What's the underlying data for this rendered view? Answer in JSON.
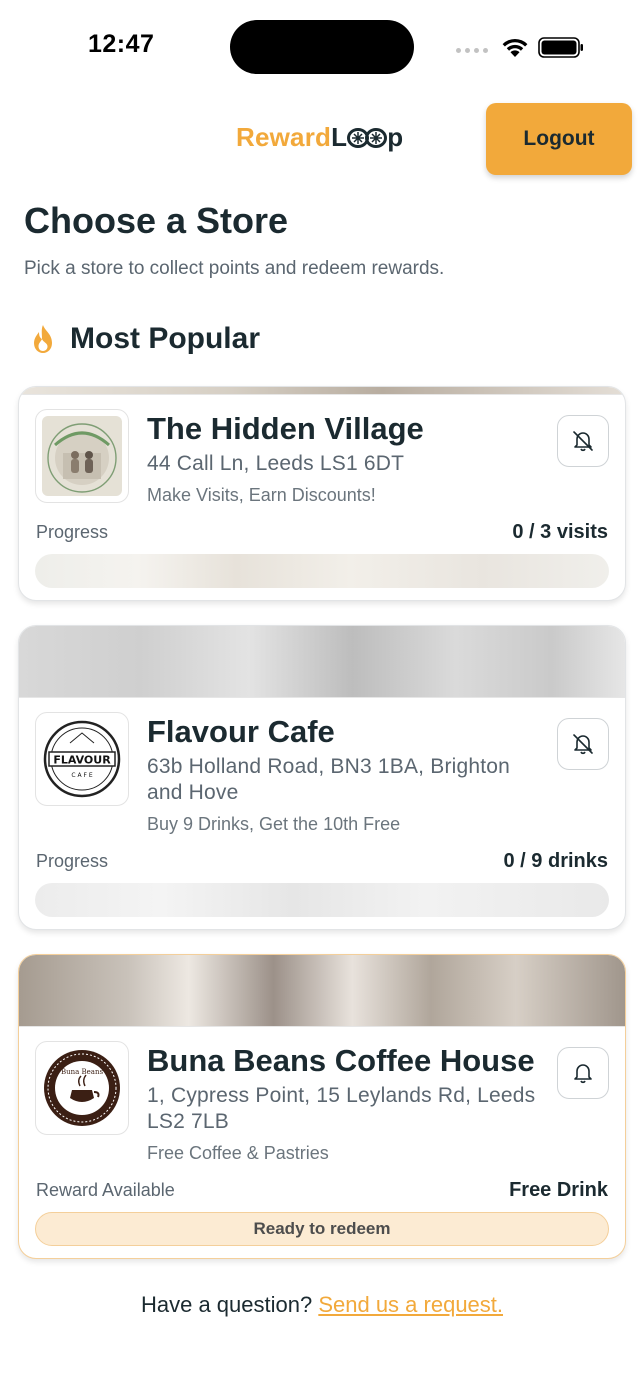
{
  "status_bar": {
    "time": "12:47",
    "icons": [
      "cellular-signal-icon",
      "wifi-icon",
      "battery-icon"
    ]
  },
  "header": {
    "logo_part1": "Reward",
    "logo_part2": "L",
    "logo_part3": "p",
    "logout_label": "Logout"
  },
  "page": {
    "title": "Choose a Store",
    "subtitle": "Pick a store to collect points and redeem rewards."
  },
  "section": {
    "icon": "fire-icon",
    "title": "Most Popular"
  },
  "stores": [
    {
      "name": "The Hidden Village",
      "address": "44 Call Ln, Leeds LS1 6DT",
      "offer": "Make Visits, Earn Discounts!",
      "status_label": "Progress",
      "status_value": "0 / 3 visits",
      "progress_fraction": 0,
      "notifications": "muted",
      "logo_text": "The Hidden Village"
    },
    {
      "name": "Flavour Cafe",
      "address": "63b Holland Road, BN3 1BA, Brighton and Hove",
      "offer": "Buy 9 Drinks, Get the 10th Free",
      "status_label": "Progress",
      "status_value": "0 / 9 drinks",
      "progress_fraction": 0,
      "notifications": "muted",
      "logo_text": "FLAVOUR CAFE"
    },
    {
      "name": "Buna Beans Coffee House",
      "address": "1, Cypress Point, 15 Leylands Rd, Leeds LS2 7LB",
      "offer": "Free Coffee & Pastries",
      "status_label": "Reward Available",
      "status_value": "Free Drink",
      "action_label": "Ready to redeem",
      "notifications": "on",
      "logo_text": "Buna Beans Coffee House"
    }
  ],
  "footer": {
    "question": "Have a question?",
    "link_label": "Send us a request."
  },
  "colors": {
    "accent": "#f2a93b",
    "text_dark": "#1b2a30",
    "text_muted": "#5b6670",
    "redeem_bg": "#fcebd3"
  }
}
